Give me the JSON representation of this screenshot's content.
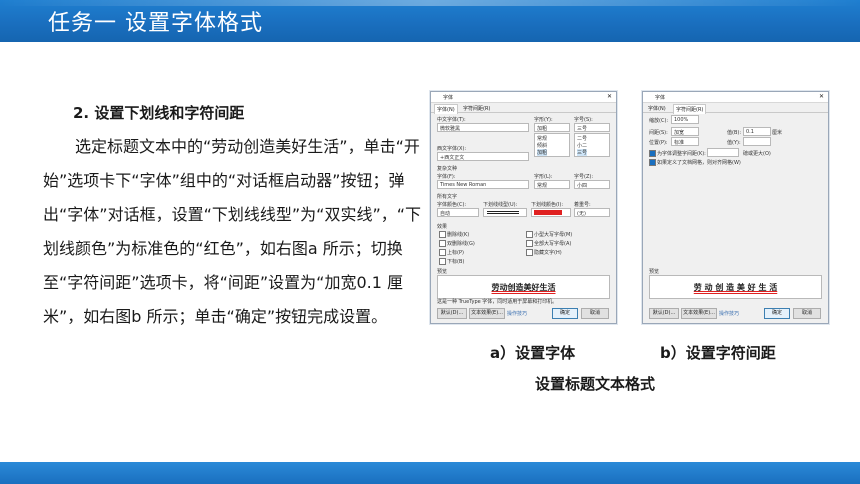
{
  "header": {
    "title": "任务一   设置字体格式"
  },
  "content": {
    "heading": "2. 设置下划线和字符间距",
    "paragraph": "选定标题文本中的“劳动创造美好生活”，单击“开始”选项卡下“字体”组中的“对话框启动器”按钮；弹出“字体”对话框，设置“下划线线型”为“双实线”，“下划线颜色”为标准色的“红色”，如右图a 所示；切换至“字符间距”选项卡，将“间距”设置为“加宽0.1 厘米”，如右图b 所示；单击“确定”按钮完成设置。"
  },
  "figure": {
    "caption_a": "a）设置字体",
    "caption_b": "b）设置字符间距",
    "caption_main": "设置标题文本格式",
    "dialog_a": {
      "title": "字体",
      "tabs": [
        "字体(N)",
        "字符间距(R)"
      ],
      "labels": [
        "中文字体(T):",
        "字形(Y):",
        "字号(S):",
        "西文字体(X):",
        "复杂文种",
        "字体(F):",
        "字形(L):",
        "字号(Z):",
        "所有文字",
        "字体颜色(C):",
        "下划线线型(U):",
        "下划线颜色(I):",
        "着重号:"
      ],
      "values": [
        "微软雅黑",
        "加粗",
        "三号",
        "+西文正文",
        "Times New Roman",
        "常规",
        "小四",
        "自动",
        "(无)"
      ],
      "style_list": [
        "常规",
        "倾斜",
        "加粗"
      ],
      "size_list": [
        "二号",
        "小二",
        "三号"
      ],
      "effects_title": "效果",
      "effects": [
        "删除线(K)",
        "双删除线(G)",
        "上标(P)",
        "下标(B)",
        "小型大写字母(M)",
        "全部大写字母(A)",
        "隐藏文字(H)"
      ],
      "preview_label": "预览",
      "preview_text": "劳动创造美好生活",
      "note": "这是一种 TrueType 字体，同时适用于屏幕和打印机。",
      "buttons": [
        "默认(D)...",
        "文本效果(E)...",
        "操作技巧",
        "确定",
        "取消"
      ],
      "underline_color": "#e02020"
    },
    "dialog_b": {
      "title": "字体",
      "tabs": [
        "字体(N)",
        "字符间距(R)"
      ],
      "labels": [
        "缩放(C):",
        "间距(S):",
        "位置(P):",
        "值(B):",
        "值(Y):"
      ],
      "values": [
        "100%",
        "加宽",
        "标准",
        "0.1",
        "厘米"
      ],
      "checks": [
        "为字体调整字间距(K):",
        "如果定义了文档网格，则对齐网格(W)"
      ],
      "kern_suffix": "磅或更大(O)",
      "preview_label": "预览",
      "preview_text": "劳 动 创 造 美 好 生 活",
      "buttons": [
        "默认(D)...",
        "文本效果(E)...",
        "操作技巧",
        "确定",
        "取消"
      ]
    }
  },
  "colors": {
    "header": "#1a6fbf",
    "accent_red": "#e02020"
  }
}
